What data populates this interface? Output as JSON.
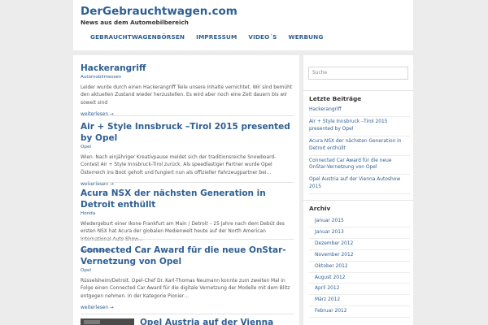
{
  "site": {
    "title": "DerGebrauchtwagen.com",
    "description": "News aus dem Automobilbereich"
  },
  "nav": [
    "GEBRAUCHTWAGENBÖRSEN",
    "IMPRESSUM",
    "VIDEO´S",
    "WERBUNG"
  ],
  "posts": [
    {
      "title": "Hackerangriff",
      "category": "Automobilmessen",
      "excerpt": "Leider wurde durch einen Hackerangriff Teile unsere Inhalte vernichtet. Wir sind bemüht den aktuellen Zustand wieder herzustellen. Es wird aber noch eine Zeit dauern bis wir soweit sind",
      "more": "weiterlesen →"
    },
    {
      "title": "Air + Style Innsbruck –Tirol 2015 presented by Opel",
      "category": "Opel",
      "excerpt": "Wien.  Nach einjähriger Kreativpause meldet sich der traditionsreiche Snowboard-Contest Air + Style Innsbruck-Tirol zurück. Als speedlastiger Partner wurde Opel Österreich ins Boot geholt und fungiert nun als offizieller Fahrzeugpartner bei…",
      "more": "weiterlesen →"
    },
    {
      "title": "Acura NSX der nächsten Generation in Detroit enthüllt",
      "category": "Honda",
      "excerpt": "Wiedergeburt einer Ikone Frankfurt am Main / Detroit – 25 Jahre nach dem Debüt des ersten NSX hat Acura der globalen Medienwelt heute auf der North American International Auto Show…",
      "more": "weiterlesen →"
    },
    {
      "title": "Connected Car Award für die neue OnStar-Vernetzung von Opel",
      "category": "Opel",
      "excerpt": "Rüsselsheim/Detroit.  Opel-Chef Dr. Karl-Thomas Neumann konnte zum zweiten Mal in Folge einen Connected Car Award für die digitale Vernetzung der Modelle mit dem Blitz entgegen nehmen. In der Kategorie Pionier…",
      "more": "weiterlesen →"
    },
    {
      "title": "Opel Austria auf der Vienna Autoshow"
    }
  ],
  "sidebar": {
    "search_placeholder": "Suche",
    "recent_title": "Letzte Beiträge",
    "recent": [
      "Hackerangriff",
      "Air + Style Innsbruck –Tirol 2015 presented by Opel",
      "Acura NSX der nächsten Generation in Detroit enthüllt",
      "Connected Car Award für die neue OnStar-Vernetzung von Opel",
      "Opel Austria auf der Vienna Autoshow 2015"
    ],
    "archive_title": "Archiv",
    "archive": [
      "Januar 2015",
      "Januar 2013",
      "Dezember 2012",
      "November 2012",
      "Oktober 2012",
      "August 2012",
      "April 2012",
      "März 2012",
      "Februar 2012"
    ]
  },
  "colors": {
    "link": "#2e5f93",
    "background": "#ececec"
  }
}
